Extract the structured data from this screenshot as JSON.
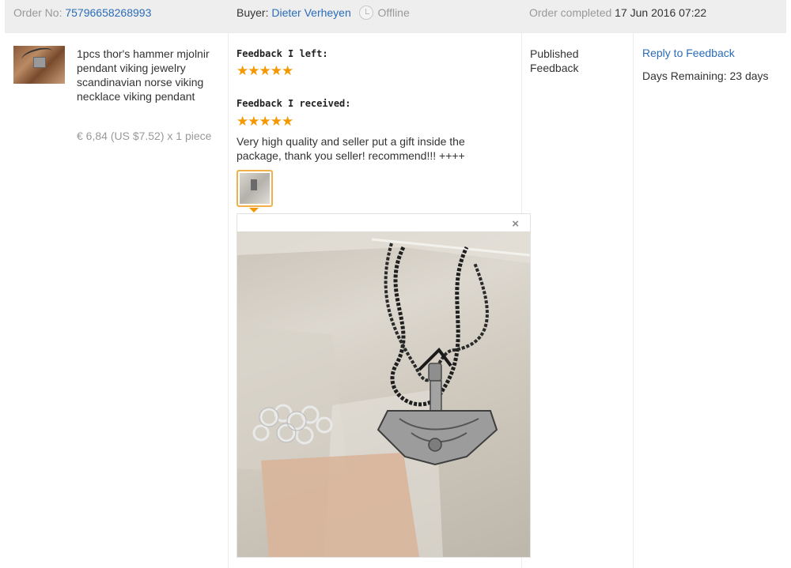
{
  "header": {
    "order_label": "Order No:",
    "order_number": "75796658268993",
    "buyer_label": "Buyer:",
    "buyer_name": "Dieter Verheyen",
    "buyer_status": "Offline",
    "completed_label": "Order completed",
    "completed_date": "17 Jun 2016 07:22"
  },
  "product": {
    "title": "1pcs thor's hammer mjolnir pendant viking jewelry scandinavian norse viking necklace viking pendant",
    "price": "€ 6,84 (US $7.52) x 1 piece"
  },
  "feedback": {
    "left_heading": "Feedback I left:",
    "left_rating": 5,
    "received_heading": "Feedback I received:",
    "received_rating": 5,
    "received_text": "Very high quality and seller put a gift inside the package, thank you seller! recommend!!! ++++",
    "close_symbol": "×"
  },
  "status": {
    "published": "Published Feedback"
  },
  "actions": {
    "reply_label": "Reply to Feedback",
    "days_remaining": "Days Remaining: 23 days"
  },
  "colors": {
    "link": "#2a6cb8",
    "star": "#f39800",
    "header_bg": "#eeeeee",
    "thumb_border": "#f2b04a"
  }
}
